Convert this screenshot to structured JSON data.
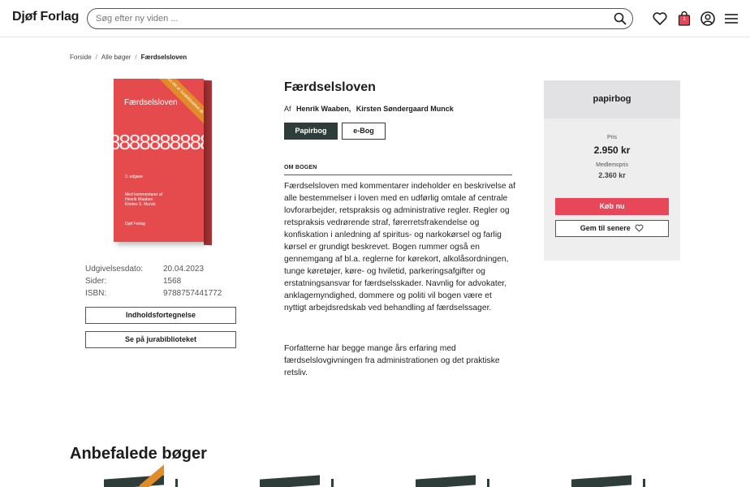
{
  "header": {
    "logo": "Djøf Forlag",
    "search_placeholder": "Søg efter ny viden ...",
    "cart_count": "1",
    "icons": [
      "search-icon",
      "heart-icon",
      "cart-icon",
      "user-icon",
      "menu-icon"
    ]
  },
  "breadcrumb": {
    "items": [
      "Forside",
      "Alle bøger",
      "Færdselsloven"
    ],
    "separator": "/"
  },
  "cover": {
    "title": "Færdselsloven",
    "digits": "8888888888",
    "edition": "3. udgave",
    "subtitle_lines": [
      "Med kommentarer af",
      "Henrik Waaben",
      "Kirsten S. Munck"
    ],
    "publisher": "Djøf Forlag",
    "ribbon": "En del af Jurabiblioteket.dk",
    "color": "#e54a4d"
  },
  "meta": {
    "rows": [
      {
        "label": "Udgivelsesdato:",
        "value": "20.04.2023"
      },
      {
        "label": "Sider:",
        "value": "1568"
      },
      {
        "label": "ISBN:",
        "value": "9788757441772"
      }
    ],
    "toc_button": "Indholdsfortegnelse",
    "library_button": "Se på jurabiblioteket"
  },
  "product": {
    "title": "Færdselsloven",
    "authors_prefix": "Af",
    "authors": [
      "Henrik Waaben,",
      "Kirsten Søndergaard Munck"
    ],
    "formats": [
      "Papirbog",
      "e-Bog"
    ],
    "active_format": "Papirbog",
    "section_heading": "OM BOGEN",
    "description": "Færdselsloven med kommentarer indeholder en beskrivelse af alle bestemmelser i loven med en udførlig omtale af centrale lovforarbejder, retspraksis og administrative regler. Regler og retspraksis vedrørende straf, førerretsfrakendelse og konfiskation i anledning af spiritus- og narkokørsel og farlig kørsel er grundigt beskrevet. Bogen rummer også en gennemgang af bl.a. reglerne for kørekort, alkolåsordningen, tunge køretøjer, køre- og hviletid, parkeringsafgifter og erstatningsansvar for færdselsskader. Navnlig for advokater, anklagemyndighed, dommere og politi vil bogen være et nyttigt arbejdsredskab ved behandling af færdselssager.",
    "description_2": "Forfatterne har begge mange års erfaring med færdselslovgivningen fra administrationen og det praktiske retsliv."
  },
  "buybox": {
    "format_heading": "papirbog",
    "price_label": "Pris",
    "price": "2.950 kr",
    "member_price_label": "Medlemspris",
    "member_price": "2.360 kr",
    "buy_button": "Køb nu",
    "save_button": "Gem til senere",
    "accent": "#e8475a"
  },
  "recommended": {
    "title": "Anbefalede bøger"
  },
  "colors": {
    "dark_green": "#2e3d3a",
    "accent_red": "#e8475a",
    "ribbon_orange": "#e08c2a"
  }
}
